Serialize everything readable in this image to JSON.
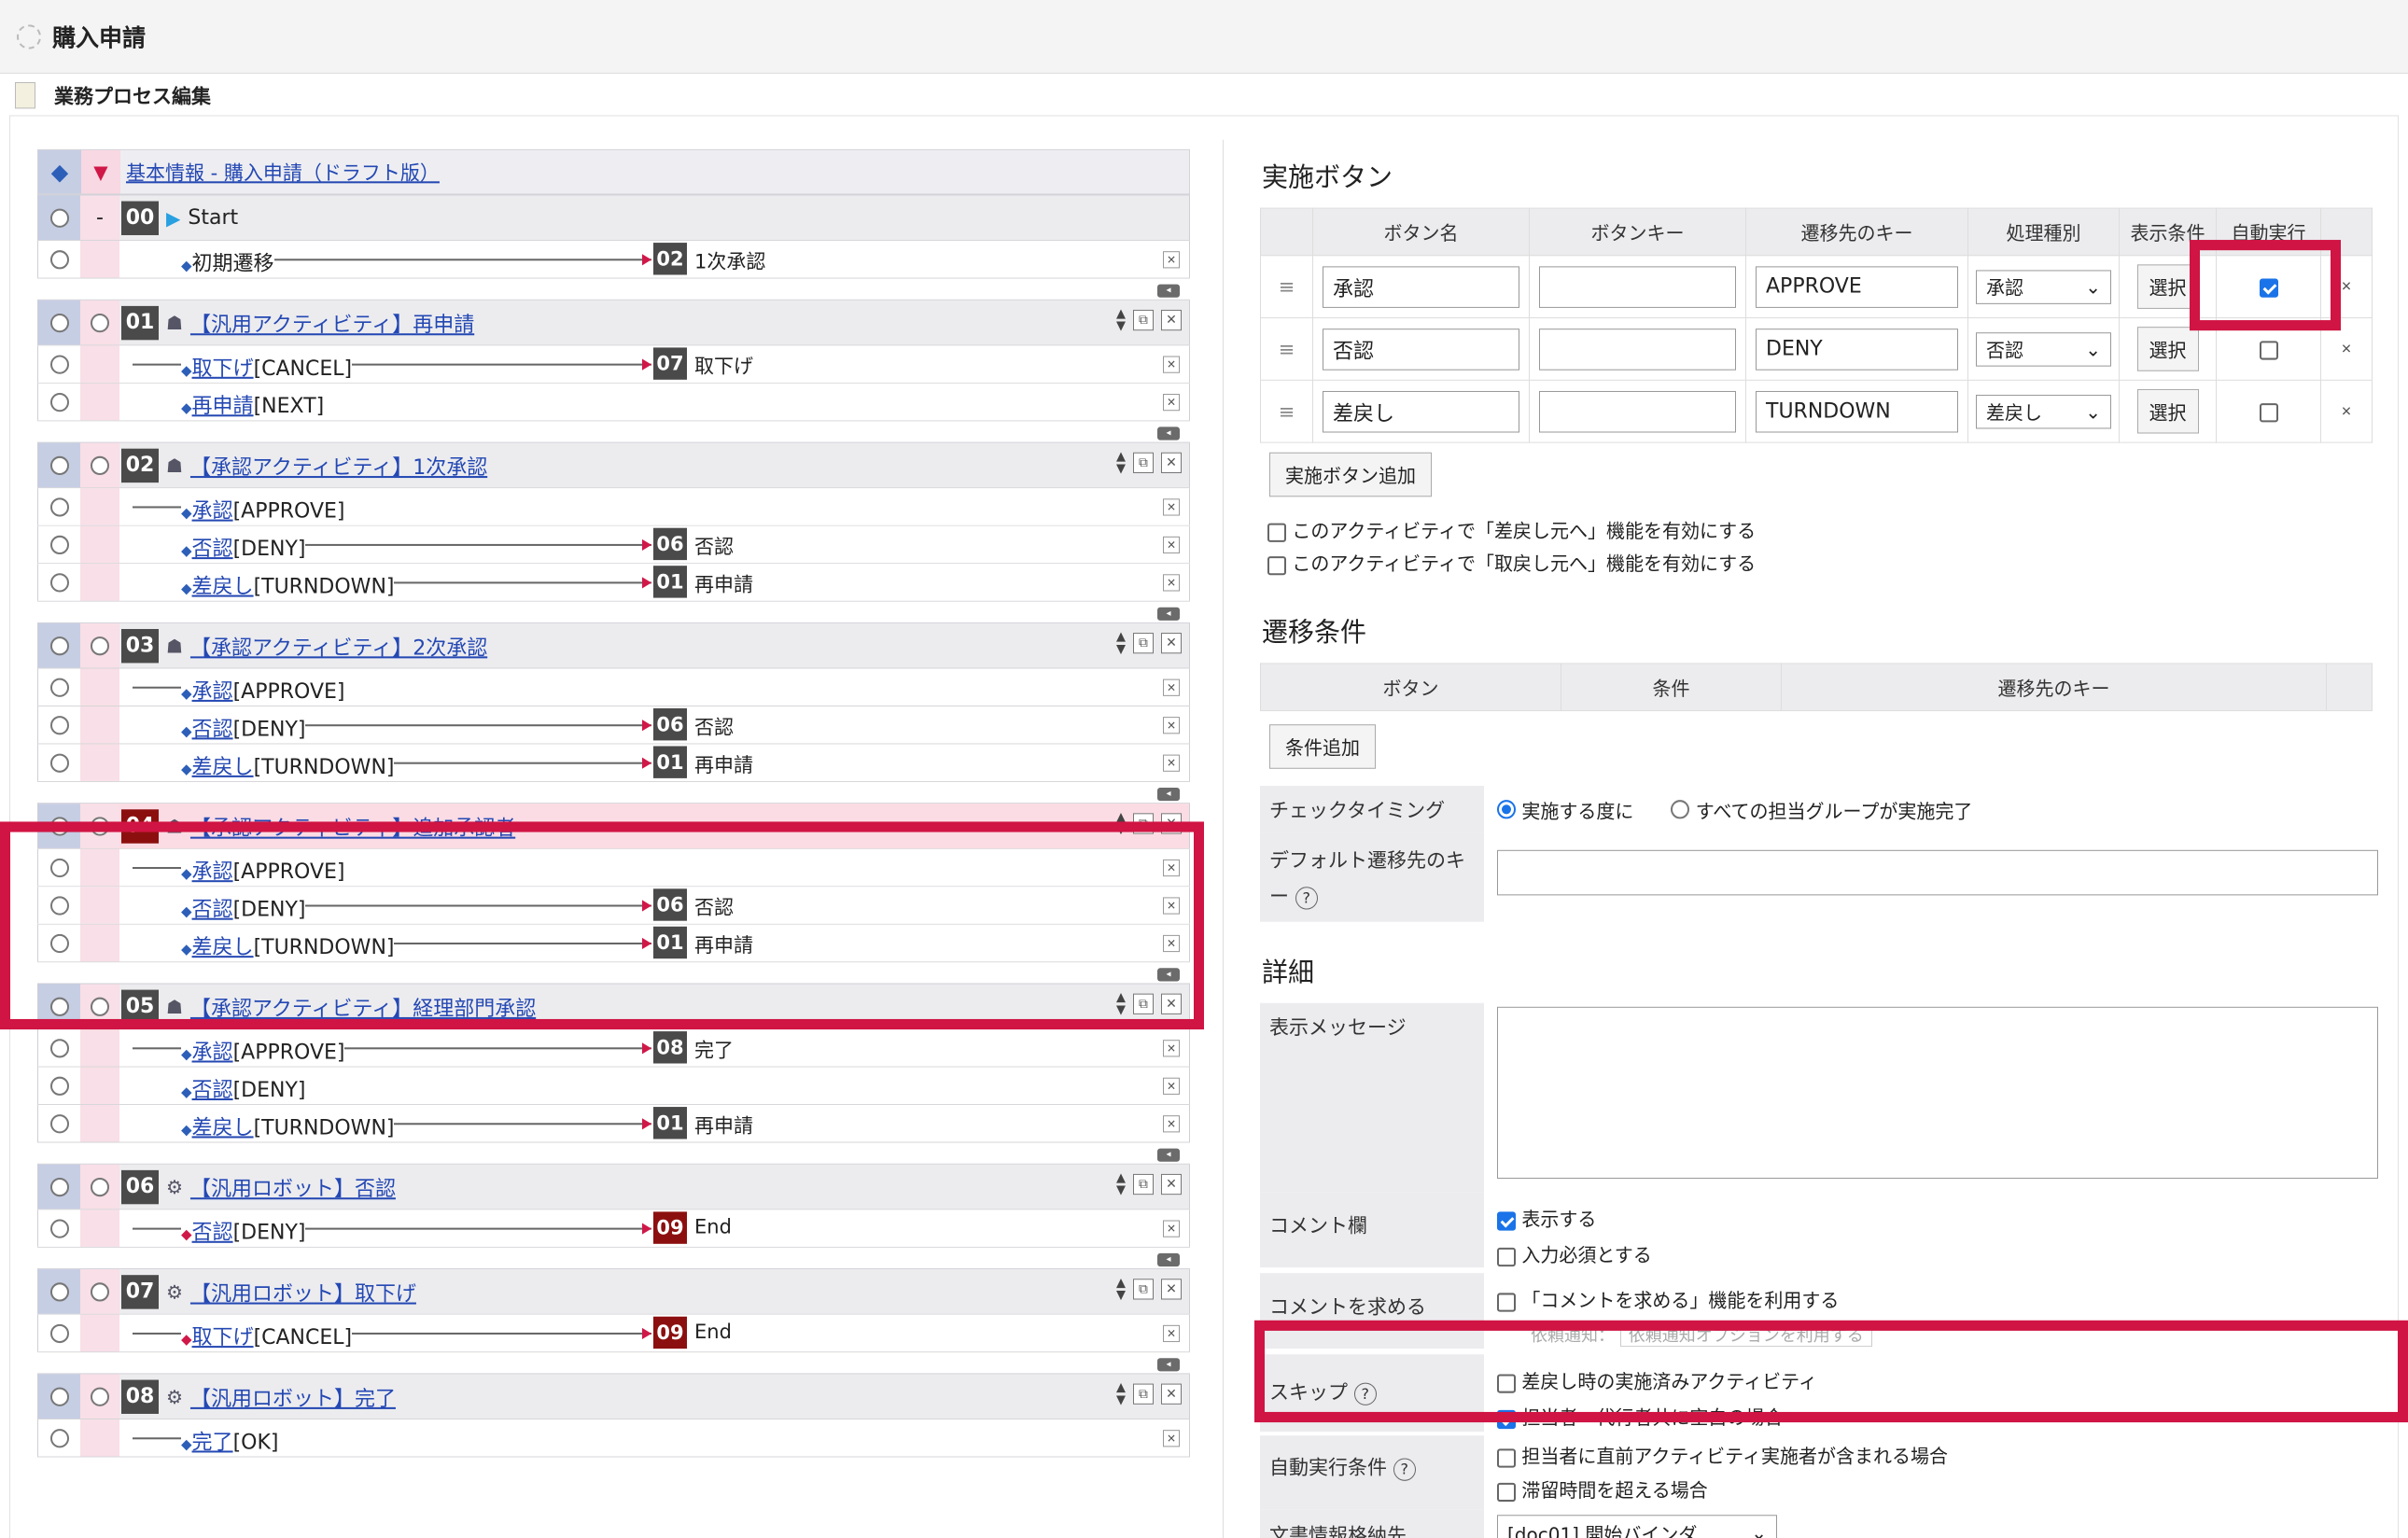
{
  "page": {
    "title": "購入申請",
    "subtitle": "業務プロセス編集"
  },
  "base": {
    "link": "基本情報 - 購入申請（ドラフト版）"
  },
  "activities": [
    {
      "num": "00",
      "icon": "play-icon",
      "title": "Start",
      "link": false,
      "rows": [
        {
          "label": "初期遷移",
          "plain": true,
          "target": "02",
          "target_text": "1次承認"
        }
      ]
    },
    {
      "num": "01",
      "icon": "people-icon",
      "title": "【汎用アクティビティ】再申請",
      "link": true,
      "rows": [
        {
          "label": "取下げ",
          "code": "[CANCEL]",
          "target": "07",
          "target_text": "取下げ"
        },
        {
          "label": "再申請",
          "code": "[NEXT]"
        }
      ]
    },
    {
      "num": "02",
      "icon": "people-icon",
      "title": "【承認アクティビティ】1次承認",
      "link": true,
      "rows": [
        {
          "label": "承認",
          "code": "[APPROVE]"
        },
        {
          "label": "否認",
          "code": "[DENY]",
          "target": "06",
          "target_text": "否認"
        },
        {
          "label": "差戻し",
          "code": "[TURNDOWN]",
          "target": "01",
          "target_text": "再申請"
        }
      ]
    },
    {
      "num": "03",
      "icon": "people-icon",
      "title": "【承認アクティビティ】2次承認",
      "link": true,
      "rows": [
        {
          "label": "承認",
          "code": "[APPROVE]"
        },
        {
          "label": "否認",
          "code": "[DENY]",
          "target": "06",
          "target_text": "否認"
        },
        {
          "label": "差戻し",
          "code": "[TURNDOWN]",
          "target": "01",
          "target_text": "再申請"
        }
      ]
    },
    {
      "num": "04",
      "icon": "people-icon",
      "title": "【承認アクティビティ】追加承認者",
      "link": true,
      "selected": true,
      "rows": [
        {
          "label": "承認",
          "code": "[APPROVE]"
        },
        {
          "label": "否認",
          "code": "[DENY]",
          "target": "06",
          "target_text": "否認"
        },
        {
          "label": "差戻し",
          "code": "[TURNDOWN]",
          "target": "01",
          "target_text": "再申請"
        }
      ]
    },
    {
      "num": "05",
      "icon": "people-icon",
      "title": "【承認アクティビティ】経理部門承認",
      "link": true,
      "rows": [
        {
          "label": "承認",
          "code": "[APPROVE]",
          "target": "08",
          "target_text": "完了"
        },
        {
          "label": "否認",
          "code": "[DENY]"
        },
        {
          "label": "差戻し",
          "code": "[TURNDOWN]",
          "target": "01",
          "target_text": "再申請"
        }
      ]
    },
    {
      "num": "06",
      "icon": "robot-icon",
      "title": "【汎用ロボット】否認",
      "link": true,
      "rows": [
        {
          "label": "否認",
          "code": "[DENY]",
          "target": "09",
          "target_text": "End",
          "red": true
        }
      ]
    },
    {
      "num": "07",
      "icon": "robot-icon",
      "title": "【汎用ロボット】取下げ",
      "link": true,
      "rows": [
        {
          "label": "取下げ",
          "code": "[CANCEL]",
          "target": "09",
          "target_text": "End",
          "red": true
        }
      ]
    },
    {
      "num": "08",
      "icon": "robot-icon",
      "title": "【汎用ロボット】完了",
      "link": true,
      "rows": [
        {
          "label": "完了",
          "code": "[OK]"
        }
      ]
    }
  ],
  "exec": {
    "heading": "実施ボタン",
    "cols": [
      "ボタン名",
      "ボタンキー",
      "遷移先のキー",
      "処理種別",
      "表示条件",
      "自動実行"
    ],
    "rows": [
      {
        "name": "承認",
        "key": "",
        "dest": "APPROVE",
        "type": "承認",
        "select": "選択",
        "auto": true
      },
      {
        "name": "否認",
        "key": "",
        "dest": "DENY",
        "type": "否認",
        "select": "選択",
        "auto": false
      },
      {
        "name": "差戻し",
        "key": "",
        "dest": "TURNDOWN",
        "type": "差戻し",
        "select": "選択",
        "auto": false
      }
    ],
    "add_label": "実施ボタン追加",
    "opt1": "このアクティビティで「差戻し元へ」機能を有効にする",
    "opt2": "このアクティビティで「取戻し元へ」機能を有効にする"
  },
  "trans": {
    "heading": "遷移条件",
    "cols": [
      "ボタン",
      "条件",
      "遷移先のキー"
    ],
    "add_label": "条件追加",
    "check_label": "チェックタイミング",
    "radio1": "実施する度に",
    "radio2": "すべての担当グループが実施完了",
    "default_label": "デフォルト遷移先のキー"
  },
  "detail": {
    "heading": "詳細",
    "msg_label": "表示メッセージ",
    "comment_label": "コメント欄",
    "show": "表示する",
    "required": "入力必須とする",
    "request_label": "コメントを求める",
    "request_opt": "「コメントを求める」機能を利用する",
    "notify": "依頼通知：",
    "notify_sel": "依頼通知オプションを利用する",
    "skip_label": "スキップ",
    "skip1": "差戻し時の実施済みアクティビティ",
    "skip2": "担当者・代行者共に空白の場合",
    "auto_label": "自動実行条件",
    "auto1": "担当者に直前アクティビティ実施者が含まれる場合",
    "auto2": "滞留時間を超える場合",
    "doc_label": "文書情報格納先",
    "doc_sel": "[doc01] 開始バインダ"
  }
}
